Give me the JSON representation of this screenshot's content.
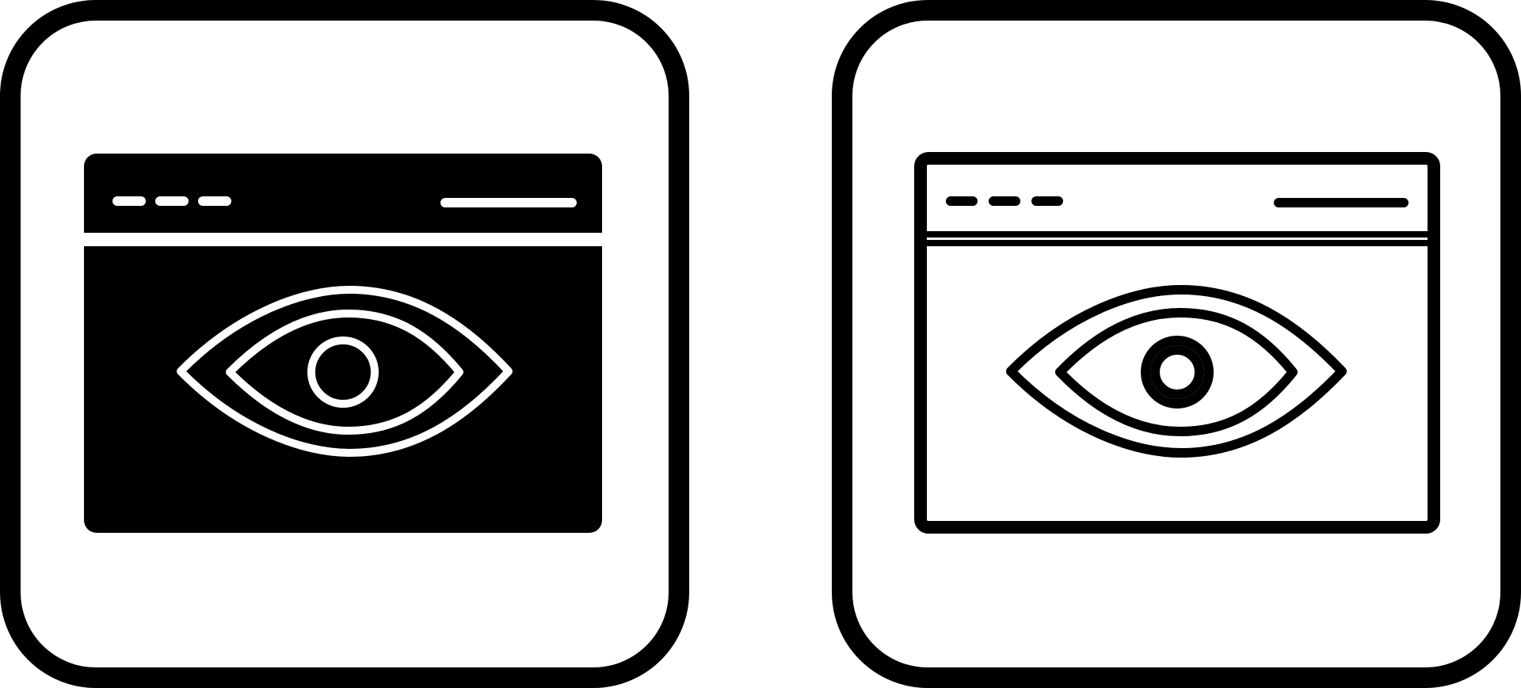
{
  "icons": [
    {
      "name": "web-view-icon-filled",
      "style": "glyph",
      "fill_color": "#000000",
      "line_color": "#ffffff"
    },
    {
      "name": "web-view-icon-outline",
      "style": "outline",
      "fill_color": "#ffffff",
      "line_color": "#000000"
    }
  ],
  "colors": {
    "background": "#ffffff",
    "frame": "#000000"
  }
}
